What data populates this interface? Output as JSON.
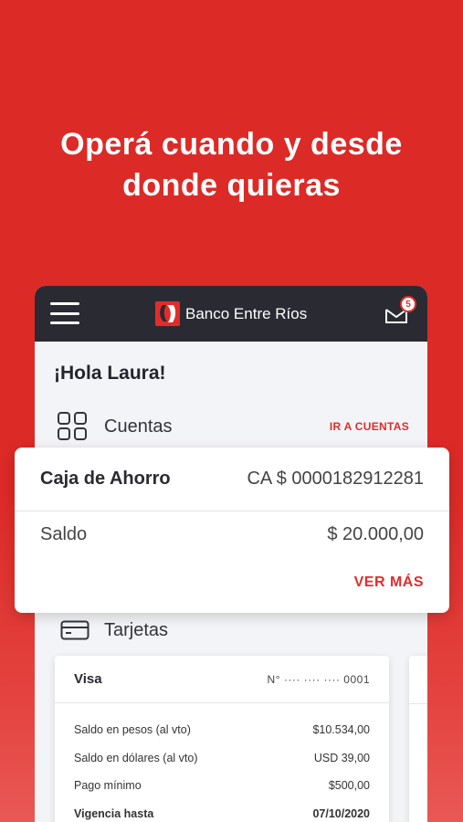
{
  "headline": {
    "line1": "Operá cuando y desde",
    "line2": "donde quieras"
  },
  "topbar": {
    "brand_name": "Banco Entre Ríos",
    "mail_badge": "5"
  },
  "greeting": "¡Hola Laura!",
  "accounts": {
    "title": "Cuentas",
    "link": "IR A CUENTAS",
    "card": {
      "type": "Caja de Ahorro",
      "number": "CA $ 0000182912281",
      "balance_label": "Saldo",
      "balance": "$ 20.000,00",
      "more": "VER MÁS"
    }
  },
  "cards": {
    "title": "Tarjetas",
    "card": {
      "brand": "Visa",
      "number": "N° ···· ···· ···· 0001",
      "rows": [
        {
          "label": "Saldo en pesos (al vto)",
          "value": "$10.534,00"
        },
        {
          "label": "Saldo en dólares (al vto)",
          "value": "USD 39,00"
        },
        {
          "label": "Pago mínimo",
          "value": "$500,00"
        },
        {
          "label": "Vigencia hasta",
          "value": "07/10/2020"
        }
      ]
    }
  },
  "colors": {
    "brand_red": "#e22c2a",
    "topbar": "#2a2b32",
    "background": "#dc2a27"
  },
  "icons": [
    "hamburger-menu-icon",
    "bank-logo-icon",
    "mail-icon",
    "accounts-grid-icon",
    "credit-card-icon"
  ]
}
